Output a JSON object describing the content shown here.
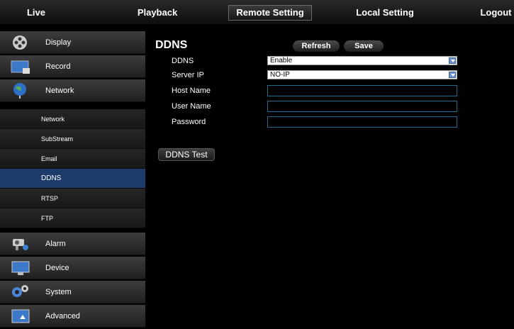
{
  "topnav": {
    "live": "Live",
    "playback": "Playback",
    "remote_setting": "Remote Setting",
    "local_setting": "Local Setting",
    "logout": "Logout"
  },
  "sidebar": {
    "display": "Display",
    "record": "Record",
    "network": "Network",
    "sub_network": "Network",
    "substream": "SubStream",
    "email": "Email",
    "ddns": "DDNS",
    "rtsp": "RTSP",
    "ftp": "FTP",
    "alarm": "Alarm",
    "device": "Device",
    "system": "System",
    "advanced": "Advanced"
  },
  "page": {
    "title": "DDNS",
    "refresh_label": "Refresh",
    "save_label": "Save",
    "ddns_test_label": "DDNS Test"
  },
  "form": {
    "ddns_label": "DDNS",
    "ddns_value": "Enable",
    "server_ip_label": "Server IP",
    "server_ip_value": "NO-IP",
    "host_name_label": "Host Name",
    "host_name_value": "",
    "user_name_label": "User Name",
    "user_name_value": "",
    "password_label": "Password",
    "password_value": ""
  },
  "colors": {
    "active_item": "#1d3c6b",
    "dropdown_arrow": "#6f95cf",
    "input_border": "#1f6d8c"
  }
}
